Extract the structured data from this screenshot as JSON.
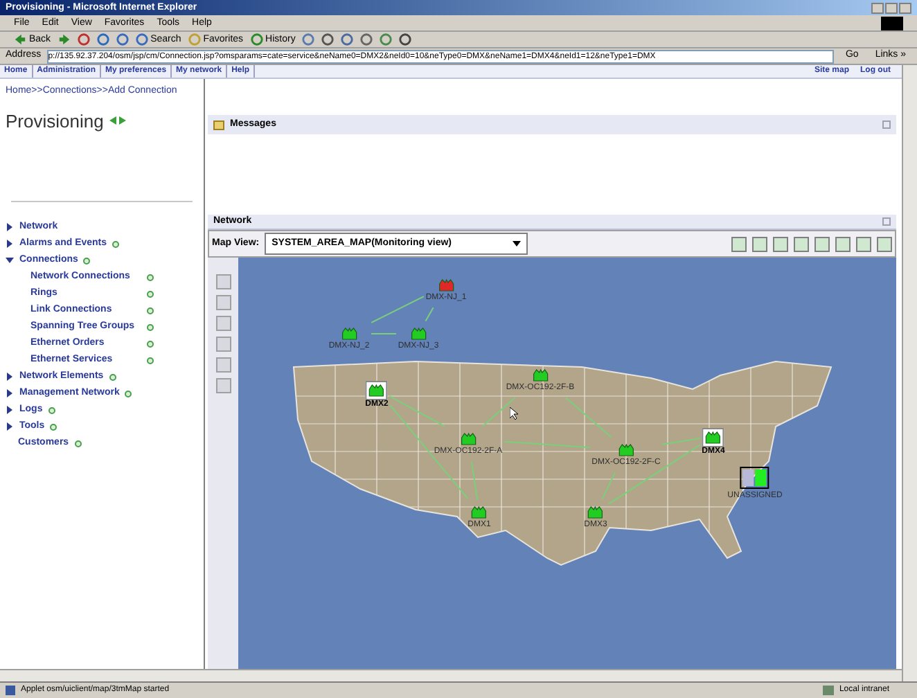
{
  "window": {
    "title": "Provisioning - Microsoft Internet Explorer"
  },
  "menu": [
    "File",
    "Edit",
    "View",
    "Favorites",
    "Tools",
    "Help"
  ],
  "toolbar": [
    {
      "label": "Back",
      "kind": "back"
    },
    {
      "kind": "forward"
    },
    {
      "kind": "stop"
    },
    {
      "kind": "refresh"
    },
    {
      "kind": "home"
    },
    {
      "label": "Search",
      "kind": "search"
    },
    {
      "label": "Favorites",
      "kind": "favorites"
    },
    {
      "label": "History",
      "kind": "history"
    },
    {
      "kind": "mail"
    },
    {
      "kind": "print"
    },
    {
      "kind": "edit"
    },
    {
      "kind": "discuss"
    },
    {
      "kind": "messenger"
    },
    {
      "kind": "user"
    }
  ],
  "address": {
    "label": "Address",
    "value": "p://135.92.37.204/osm/jsp/cm/Connection.jsp?omsparams=cate=service&neName0=DMX2&neId0=10&neType0=DMX&neName1=DMX4&neId1=12&neType1=DMX",
    "go": "Go",
    "links": "Links »"
  },
  "app_nav": {
    "tabs": [
      "Home",
      "Administration",
      "My preferences",
      "My network",
      "Help"
    ],
    "right_links": [
      "Site map",
      "Log out"
    ]
  },
  "breadcrumb": "Home>>Connections>>Add Connection",
  "page_title": "Provisioning",
  "messages_panel": {
    "title": "Messages"
  },
  "sidebar": {
    "items": [
      {
        "label": "Network",
        "kind": "folder",
        "expanded": false,
        "shortcut": false
      },
      {
        "label": "Alarms and Events",
        "kind": "folder",
        "expanded": false,
        "shortcut": true
      },
      {
        "label": "Connections",
        "kind": "folder",
        "expanded": true,
        "shortcut": true,
        "children": [
          {
            "label": "Network Connections",
            "shortcut": true
          },
          {
            "label": "Rings",
            "shortcut": true
          },
          {
            "label": "Link Connections",
            "shortcut": true
          },
          {
            "label": "Spanning Tree Groups",
            "shortcut": true
          },
          {
            "label": "Ethernet Orders",
            "shortcut": true
          },
          {
            "label": "Ethernet Services",
            "shortcut": true
          }
        ]
      },
      {
        "label": "Network Elements",
        "kind": "folder",
        "expanded": false,
        "shortcut": true
      },
      {
        "label": "Management Network",
        "kind": "folder",
        "expanded": false,
        "shortcut": true
      },
      {
        "label": "Logs",
        "kind": "folder",
        "expanded": false,
        "shortcut": true
      },
      {
        "label": "Tools",
        "kind": "folder",
        "expanded": false,
        "shortcut": true
      },
      {
        "label": "Customers",
        "kind": "leaf",
        "shortcut": true
      }
    ]
  },
  "network_panel": {
    "title": "Network",
    "map_view_label": "Map View:",
    "map_view_value": "SYSTEM_AREA_MAP(Monitoring view)"
  },
  "map_nodes": [
    {
      "name": "DMX-NJ_1",
      "kind": "ne",
      "color": "#e02828",
      "selected": false
    },
    {
      "name": "DMX-NJ_2",
      "kind": "ne",
      "color": "#22cc22",
      "selected": false
    },
    {
      "name": "DMX-NJ_3",
      "kind": "ne",
      "color": "#22cc22",
      "selected": false
    },
    {
      "name": "DMX2",
      "kind": "ne",
      "color": "#22cc22",
      "selected": true
    },
    {
      "name": "DMX-OC192-2F-B",
      "kind": "ne",
      "color": "#22cc22",
      "selected": false
    },
    {
      "name": "DMX-OC192-2F-A",
      "kind": "ne",
      "color": "#22cc22",
      "selected": false
    },
    {
      "name": "DMX-OC192-2F-C",
      "kind": "ne",
      "color": "#22cc22",
      "selected": false
    },
    {
      "name": "DMX4",
      "kind": "ne",
      "color": "#22cc22",
      "selected": true
    },
    {
      "name": "UNASSIGNED",
      "kind": "group",
      "color": "#22ee22",
      "selected": false
    },
    {
      "name": "DMX1",
      "kind": "ne",
      "color": "#22cc22",
      "selected": false
    },
    {
      "name": "DMX3",
      "kind": "ne",
      "color": "#22cc22",
      "selected": false
    }
  ],
  "status_bar": {
    "text": "Applet osm/uiclient/map/3tmMap started",
    "zone": "Local intranet"
  }
}
